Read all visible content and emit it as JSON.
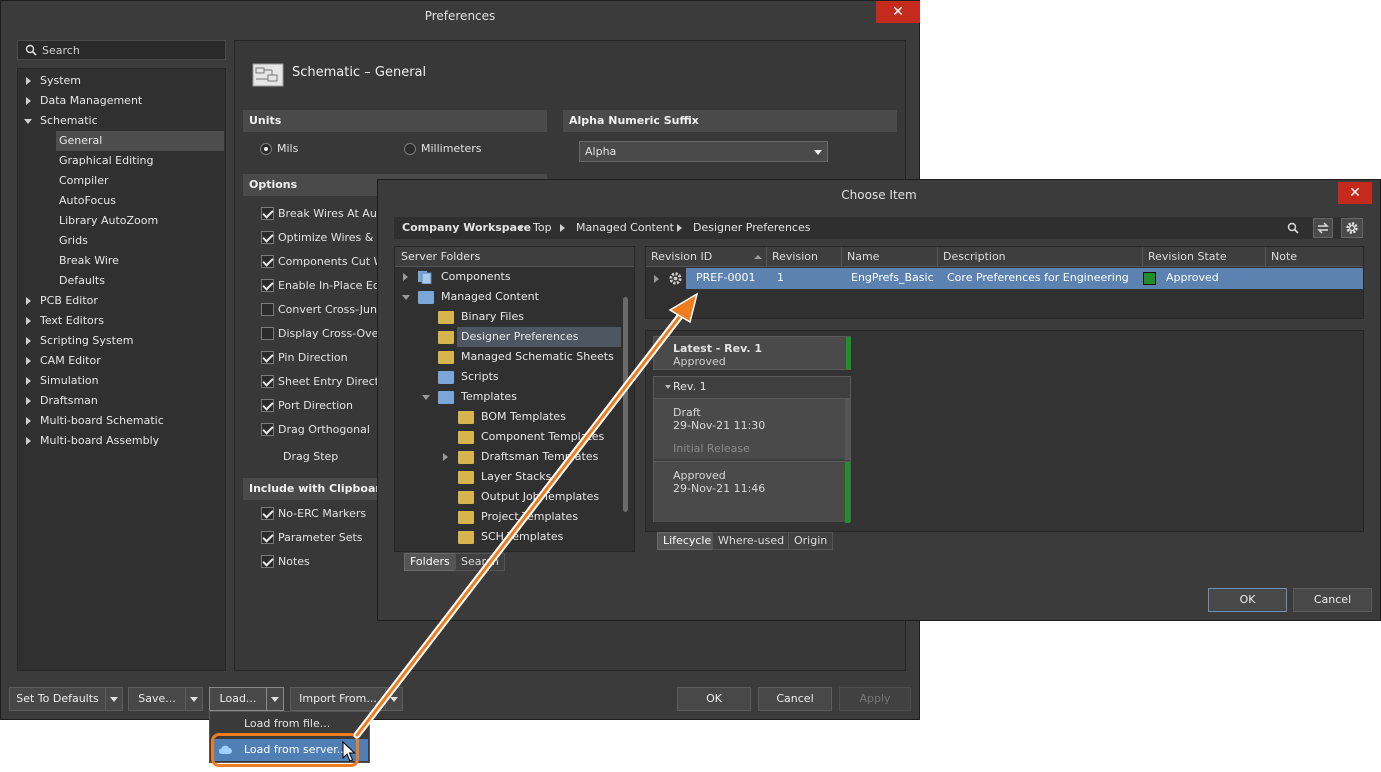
{
  "prefs": {
    "title": "Preferences",
    "close": "✕",
    "search_placeholder": "Search",
    "tree": [
      "System",
      "Data Management",
      "Schematic",
      "General",
      "Graphical Editing",
      "Compiler",
      "AutoFocus",
      "Library AutoZoom",
      "Grids",
      "Break Wire",
      "Defaults",
      "PCB Editor",
      "Text Editors",
      "Scripting System",
      "CAM Editor",
      "Simulation",
      "Draftsman",
      "Multi-board Schematic",
      "Multi-board Assembly"
    ],
    "page_title": "Schematic – General",
    "units": {
      "header": "Units",
      "mils": "Mils",
      "mm": "Millimeters",
      "selected": "Mils"
    },
    "alpha": {
      "header": "Alpha Numeric Suffix",
      "value": "Alpha"
    },
    "options": {
      "header": "Options",
      "items": [
        "Break Wires At Autojunctions",
        "Optimize Wires & Buses",
        "Components Cut Wires",
        "Enable In-Place Editing",
        "Convert Cross-Junctions",
        "Display Cross-Overs",
        "Pin Direction",
        "Sheet Entry Direction",
        "Port Direction",
        "Drag Orthogonal"
      ],
      "checked": [
        true,
        true,
        true,
        true,
        false,
        false,
        true,
        true,
        true,
        true
      ],
      "drag_step": "Drag Step"
    },
    "clipboard": {
      "header": "Include with Clipboard",
      "items": [
        "No-ERC Markers",
        "Parameter Sets",
        "Notes"
      ],
      "checked": [
        true,
        true,
        true
      ]
    },
    "buttons": {
      "defaults": "Set To Defaults",
      "save": "Save...",
      "load": "Load...",
      "import": "Import From...",
      "ok": "OK",
      "cancel": "Cancel",
      "apply": "Apply"
    },
    "load_menu": [
      "Load from file...",
      "Load from server..."
    ]
  },
  "choose": {
    "title": "Choose Item",
    "close": "✕",
    "workspace": "Company Workspace",
    "breadcrumb": [
      "Top",
      "Managed Content",
      "Designer Preferences"
    ],
    "folders_header": "Server Folders",
    "folders": [
      "Components",
      "Managed Content",
      "Binary Files",
      "Designer Preferences",
      "Managed Schematic Sheets",
      "Scripts",
      "Templates",
      "BOM Templates",
      "Component Templates",
      "Draftsman Templates",
      "Layer Stacks",
      "Output Job Templates",
      "Project Templates",
      "SCH Templates"
    ],
    "folder_tabs": [
      "Folders",
      "Search"
    ],
    "columns": [
      "Revision ID",
      "Revision",
      "Name",
      "Description",
      "Revision State",
      "Note"
    ],
    "row": {
      "id": "PREF-0001",
      "rev": "1",
      "name": "EngPrefs_Basic",
      "desc": "Core Preferences for Engineering",
      "state": "Approved",
      "state_color": "#1f8f2a"
    },
    "latest": {
      "title": "Latest - Rev. 1",
      "state": "Approved"
    },
    "rev_header": "Rev. 1",
    "history": [
      {
        "state": "Draft",
        "date": "29-Nov-21 11:30",
        "note": "Initial Release"
      },
      {
        "state": "Approved",
        "date": "29-Nov-21 11:46",
        "note": ""
      }
    ],
    "detail_tabs": [
      "Lifecycle",
      "Where-used",
      "Origin"
    ],
    "ok": "OK",
    "cancel": "Cancel"
  },
  "accent": "#f07d1d"
}
